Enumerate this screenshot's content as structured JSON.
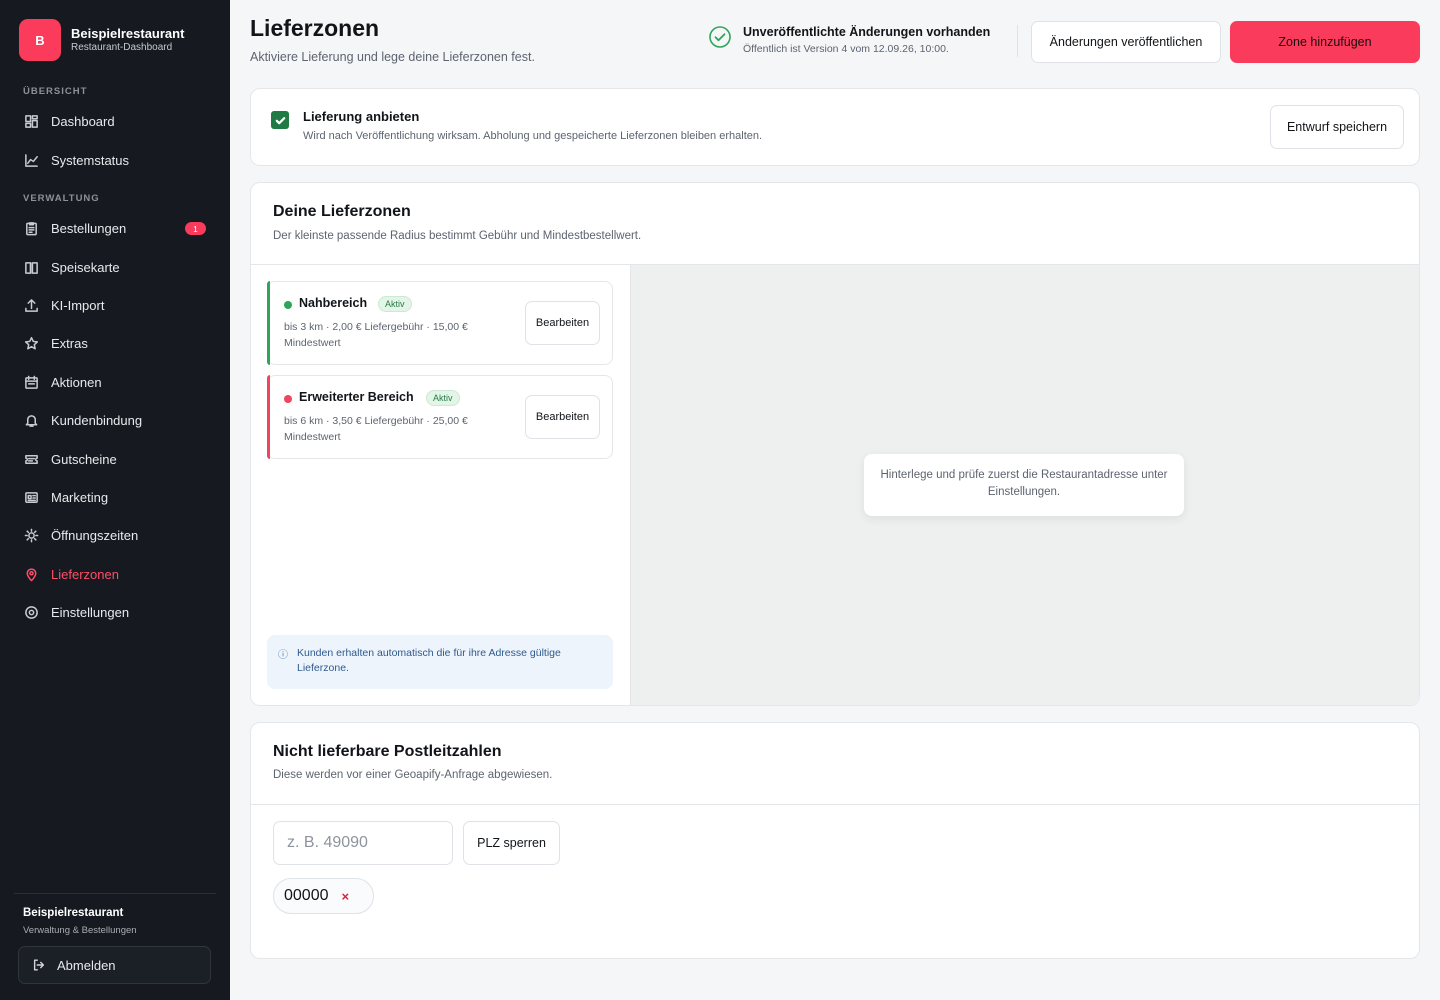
{
  "sidebar": {
    "brand_initial": "B",
    "brand_name": "Beispielrestaurant",
    "brand_sub": "Restaurant-Dashboard",
    "section_overview": "ÜBERSICHT",
    "section_admin": "VERWALTUNG",
    "items": [
      {
        "label": "Dashboard",
        "icon": "dashboard-icon"
      },
      {
        "label": "Systemstatus",
        "icon": "chart-icon"
      },
      {
        "label": "Bestellungen",
        "icon": "clipboard-icon",
        "badge": "1"
      },
      {
        "label": "Speisekarte",
        "icon": "book-icon"
      },
      {
        "label": "KI-Import",
        "icon": "upload-icon"
      },
      {
        "label": "Extras",
        "icon": "star-icon"
      },
      {
        "label": "Aktionen",
        "icon": "calendar-icon"
      },
      {
        "label": "Kundenbindung",
        "icon": "bell-icon"
      },
      {
        "label": "Gutscheine",
        "icon": "ticket-icon"
      },
      {
        "label": "Marketing",
        "icon": "newspaper-icon"
      },
      {
        "label": "Öffnungszeiten",
        "icon": "sun-icon"
      },
      {
        "label": "Lieferzonen",
        "icon": "map-pin-icon",
        "active": true
      },
      {
        "label": "Einstellungen",
        "icon": "gear-icon"
      }
    ],
    "footer_name": "Beispielrestaurant",
    "footer_sub": "Verwaltung & Bestellungen",
    "logout_label": "Abmelden"
  },
  "header": {
    "title": "Lieferzonen",
    "subtitle": "Aktiviere Lieferung und lege deine Lieferzonen fest.",
    "status_title": "Unveröffentlichte Änderungen vorhanden",
    "status_sub": "Öffentlich ist Version 4 vom 12.09.26, 10:00.",
    "publish_label": "Änderungen veröffentlichen",
    "add_zone_label": "Zone hinzufügen"
  },
  "delivery": {
    "checked": true,
    "title": "Lieferung anbieten",
    "description": "Wird nach Veröffentlichung wirksam. Abholung und gespeicherte Lieferzonen bleiben erhalten.",
    "save_draft_label": "Entwurf speichern"
  },
  "zones_section": {
    "title": "Deine Lieferzonen",
    "subtitle": "Der kleinste passende Radius bestimmt Gebühr und Mindestbestellwert.",
    "zones": [
      {
        "name": "Nahbereich",
        "status": "Aktiv",
        "details": "bis 3 km · 2,00 € Liefergebühr · 15,00 € Mindestwert",
        "color": "#2fa55a",
        "edit_label": "Bearbeiten"
      },
      {
        "name": "Erweiterter Bereich",
        "status": "Aktiv",
        "details": "bis 6 km · 3,50 € Liefergebühr · 25,00 € Mindestwert",
        "color": "#f0445f",
        "edit_label": "Bearbeiten"
      }
    ],
    "info_icon": "ⓘ",
    "info_text": "Kunden erhalten automatisch die für ihre Adresse gültige Lieferzone.",
    "map_note": "Hinterlege und prüfe zuerst die Restaurantadresse unter Einstellungen."
  },
  "plz_section": {
    "title": "Nicht lieferbare Postleitzahlen",
    "subtitle": "Diese werden vor einer Geoapify-Anfrage abgewiesen.",
    "input_placeholder": "z. B. 49090",
    "input_value": "",
    "block_label": "PLZ sperren",
    "blocked": [
      "00000"
    ],
    "remove_symbol": "×"
  },
  "colors": {
    "accent": "#fb3b5b",
    "sidebar_bg": "#161a20",
    "success": "#2fa55a",
    "checkbox": "#1f7a43"
  }
}
